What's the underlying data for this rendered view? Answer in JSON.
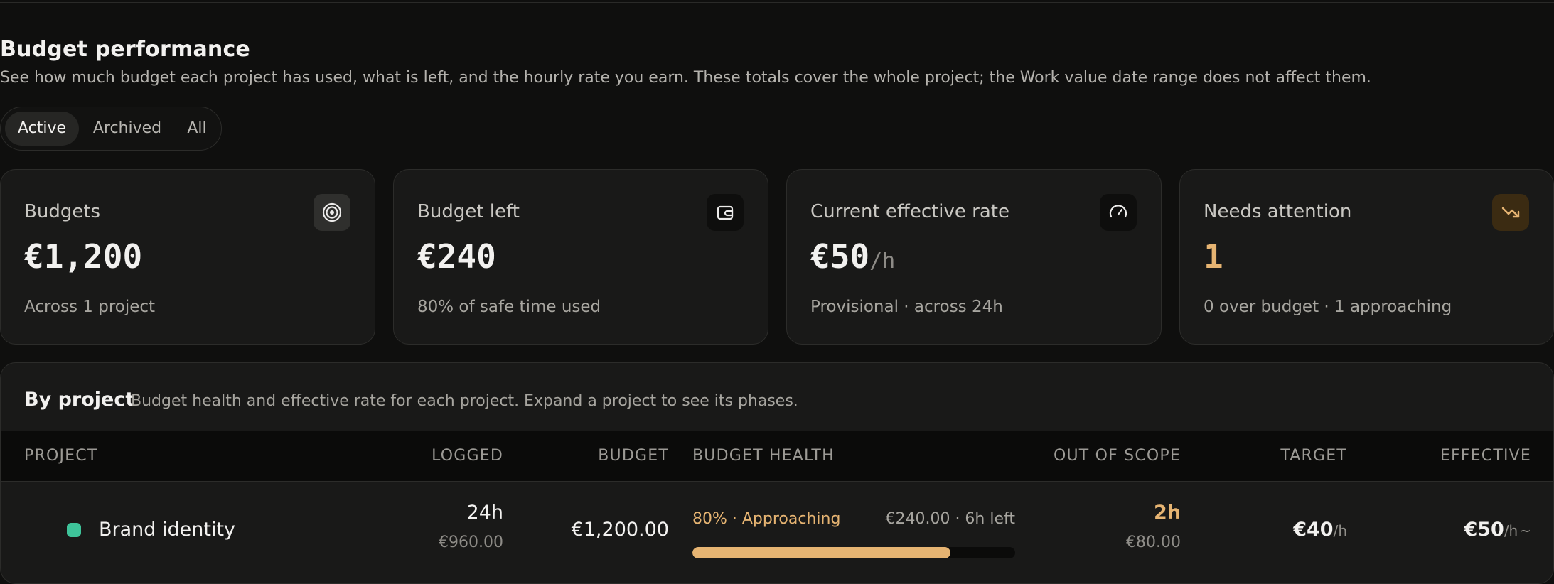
{
  "section": {
    "title": "Budget performance",
    "subtitle": "See how much budget each project has used, what is left, and the hourly rate you earn. These totals cover the whole project; the Work value date range does not affect them."
  },
  "filter": {
    "options": [
      "Active",
      "Archived",
      "All"
    ],
    "selected": "Active"
  },
  "cards": {
    "budgets": {
      "label": "Budgets",
      "value": "€1,200",
      "sub": "Across 1 project",
      "icon": "target-icon"
    },
    "left": {
      "label": "Budget left",
      "value": "€240",
      "sub": "80% of safe time used",
      "icon": "wallet-icon"
    },
    "rate": {
      "label": "Current effective rate",
      "value": "€50",
      "unit": "/h",
      "sub": "Provisional · across 24h",
      "icon": "gauge-icon"
    },
    "attention": {
      "label": "Needs attention",
      "value": "1",
      "sub": "0 over budget · 1 approaching",
      "icon": "trending-down-icon"
    }
  },
  "table": {
    "title": "By project",
    "description": "Budget health and effective rate for each project. Expand a project to see its phases.",
    "headers": {
      "project": "PROJECT",
      "logged": "LOGGED",
      "budget": "BUDGET",
      "health": "BUDGET HEALTH",
      "oos": "OUT OF SCOPE",
      "target": "TARGET",
      "effective": "EFFECTIVE"
    },
    "rows": [
      {
        "name": "Brand identity",
        "logged_hours": "24h",
        "logged_value": "€960.00",
        "budget": "€1,200.00",
        "health_status": "80% · Approaching",
        "health_left": "€240.00 · 6h left",
        "health_pct": 0.8,
        "oos_hours": "2h",
        "oos_value": "€80.00",
        "target": "€40",
        "target_unit": "/h",
        "effective": "€50",
        "effective_unit": "/h",
        "effective_flag": "~"
      }
    ]
  },
  "colors": {
    "accent_amber": "#e6b472",
    "status_green": "#3ec49a",
    "background": "#0f0f0e",
    "card": "#191918"
  }
}
